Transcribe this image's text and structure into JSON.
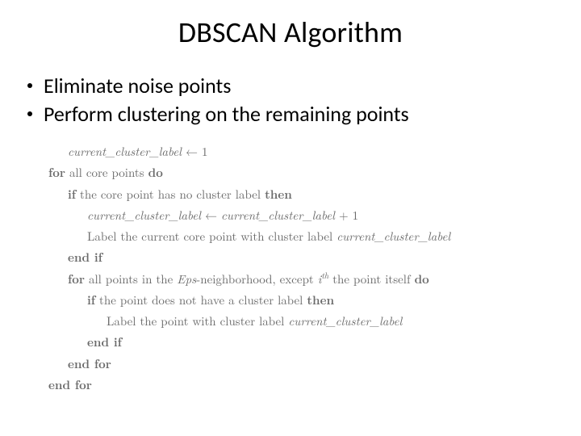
{
  "title": "DBSCAN Algorithm",
  "bullets": [
    "Eliminate noise points",
    "Perform clustering on the remaining points"
  ],
  "pseudo": {
    "l1_var": "current_cluster_label",
    "l1_op": " ← 1",
    "l2_kw1": "for",
    "l2_txt": " all core points ",
    "l2_kw2": "do",
    "l3_kw1": "if",
    "l3_txt": " the core point has no cluster label ",
    "l3_kw2": "then",
    "l4_var1": "current_cluster_label",
    "l4_mid": " ← ",
    "l4_var2": "current_cluster_label",
    "l4_end": " + 1",
    "l5_txt": "Label the current core point with cluster label ",
    "l5_var": "current_cluster_label",
    "l6_kw": "end if",
    "l7_kw1": "for",
    "l7_txt1": " all points in the ",
    "l7_var1": "Eps",
    "l7_txt2": "-neighborhood, except ",
    "l7_var2": "i",
    "l7_sup": "th",
    "l7_txt3": " the point itself ",
    "l7_kw2": "do",
    "l8_kw1": "if",
    "l8_txt": " the point does not have a cluster label ",
    "l8_kw2": "then",
    "l9_txt": "Label the point with cluster label ",
    "l9_var": "current_cluster_label",
    "l10_kw": "end if",
    "l11_kw": "end for",
    "l12_kw": "end for"
  }
}
